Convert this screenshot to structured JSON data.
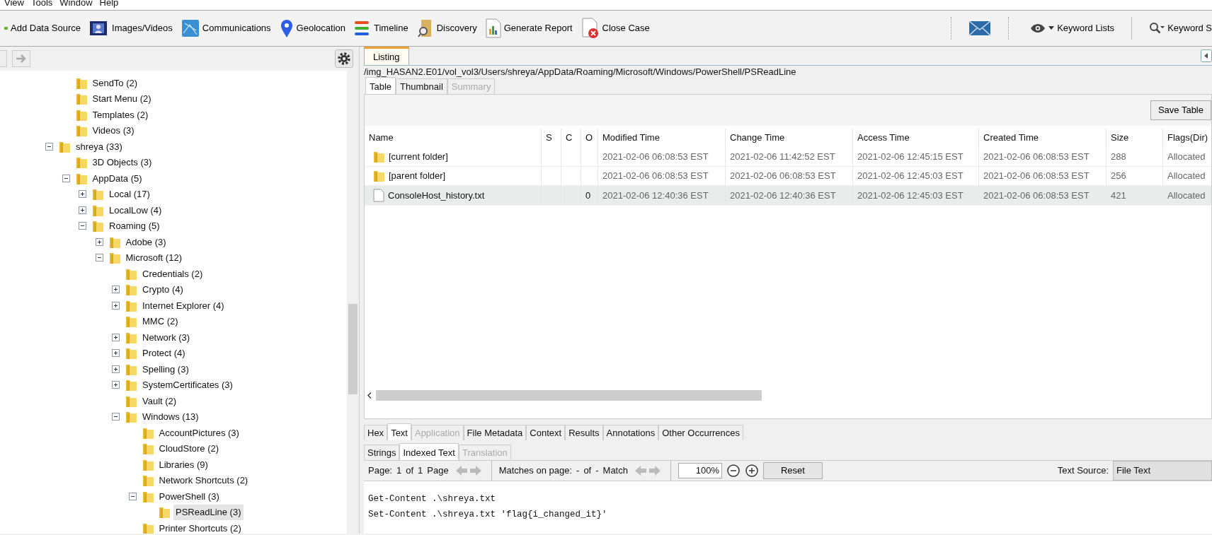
{
  "menu": [
    "View",
    "Tools",
    "Window",
    "Help"
  ],
  "toolbar": [
    {
      "label": "Add Data Source"
    },
    {
      "label": "Images/Videos"
    },
    {
      "label": "Communications"
    },
    {
      "label": "Geolocation"
    },
    {
      "label": "Timeline"
    },
    {
      "label": "Discovery"
    },
    {
      "label": "Generate Report"
    },
    {
      "label": "Close Case"
    }
  ],
  "toolbar_right": [
    {
      "label": "Keyword Lists"
    },
    {
      "label": "Keyword S"
    }
  ],
  "tree": [
    {
      "children": [
        {
          "label": "SendTo (2)"
        },
        {
          "label": "Start Menu (2)"
        },
        {
          "label": "Templates (2)"
        },
        {
          "label": "Videos (3)"
        }
      ]
    },
    {
      "label": "shreya (33)",
      "expanded": true,
      "children": [
        {
          "label": "3D Objects (3)"
        },
        {
          "label": "AppData (5)",
          "expanded": true,
          "children": [
            {
              "label": "Local (17)",
              "expanded": false
            },
            {
              "label": "LocalLow (4)",
              "expanded": false
            },
            {
              "label": "Roaming (5)",
              "expanded": true,
              "children": [
                {
                  "label": "Adobe (3)",
                  "expanded": false
                },
                {
                  "label": "Microsoft (12)",
                  "expanded": true,
                  "children": [
                    {
                      "label": "Credentials (2)"
                    },
                    {
                      "label": "Crypto (4)",
                      "expanded": false
                    },
                    {
                      "label": "Internet Explorer (4)",
                      "expanded": false
                    },
                    {
                      "label": "MMC (2)"
                    },
                    {
                      "label": "Network (3)",
                      "expanded": false
                    },
                    {
                      "label": "Protect (4)",
                      "expanded": false
                    },
                    {
                      "label": "Spelling (3)",
                      "expanded": false
                    },
                    {
                      "label": "SystemCertificates (3)",
                      "expanded": false
                    },
                    {
                      "label": "Vault (2)"
                    },
                    {
                      "label": "Windows (13)",
                      "expanded": true,
                      "children": [
                        {
                          "label": "AccountPictures (3)"
                        },
                        {
                          "label": "CloudStore (2)"
                        },
                        {
                          "label": "Libraries (9)"
                        },
                        {
                          "label": "Network Shortcuts (2)"
                        },
                        {
                          "label": "PowerShell (3)",
                          "expanded": true,
                          "children": [
                            {
                              "label": "PSReadLine (3)",
                              "selected": true
                            }
                          ]
                        },
                        {
                          "label": "Printer Shortcuts (2)"
                        }
                      ]
                    }
                  ]
                }
              ]
            }
          ]
        }
      ]
    }
  ],
  "listing": {
    "tab": "Listing",
    "path": "/img_HASAN2.E01/vol_vol3/Users/shreya/AppData/Roaming/Microsoft/Windows/PowerShell/PSReadLine",
    "tabs": [
      {
        "label": "Table",
        "selected": true,
        "disabled": false
      },
      {
        "label": "Thumbnail",
        "selected": false,
        "disabled": false
      },
      {
        "label": "Summary",
        "selected": false,
        "disabled": true
      }
    ],
    "save_button": "Save Table",
    "columns": [
      "Name",
      "S",
      "C",
      "O",
      "Modified Time",
      "Change Time",
      "Access Time",
      "Created Time",
      "Size",
      "Flags(Dir)"
    ],
    "rows": [
      {
        "kind": "folder",
        "selected": false,
        "cells": [
          "[current folder]",
          "",
          "",
          "",
          "2021-02-06 06:08:53 EST",
          "2021-02-06 11:42:52 EST",
          "2021-02-06 12:45:15 EST",
          "2021-02-06 06:08:53 EST",
          "288",
          "Allocated"
        ]
      },
      {
        "kind": "folder",
        "selected": false,
        "cells": [
          "[parent folder]",
          "",
          "",
          "",
          "2021-02-06 06:08:53 EST",
          "2021-02-06 06:08:53 EST",
          "2021-02-06 12:45:03 EST",
          "2021-02-06 06:08:53 EST",
          "256",
          "Allocated"
        ]
      },
      {
        "kind": "file",
        "selected": true,
        "cells": [
          "ConsoleHost_history.txt",
          "",
          "",
          "0",
          "2021-02-06 12:40:36 EST",
          "2021-02-06 12:40:36 EST",
          "2021-02-06 12:45:03 EST",
          "2021-02-06 06:08:53 EST",
          "421",
          "Allocated"
        ]
      }
    ]
  },
  "content": {
    "tabs": [
      {
        "label": "Hex",
        "selected": false,
        "disabled": false
      },
      {
        "label": "Text",
        "selected": true,
        "disabled": false
      },
      {
        "label": "Application",
        "selected": false,
        "disabled": true
      },
      {
        "label": "File Metadata",
        "selected": false,
        "disabled": false
      },
      {
        "label": "Context",
        "selected": false,
        "disabled": false
      },
      {
        "label": "Results",
        "selected": false,
        "disabled": false
      },
      {
        "label": "Annotations",
        "selected": false,
        "disabled": false
      },
      {
        "label": "Other Occurrences",
        "selected": false,
        "disabled": false
      }
    ],
    "subtabs": [
      {
        "label": "Strings",
        "selected": false,
        "disabled": false
      },
      {
        "label": "Indexed Text",
        "selected": true,
        "disabled": false
      },
      {
        "label": "Translation",
        "selected": false,
        "disabled": true
      }
    ],
    "page_label": "Page:",
    "page": "1",
    "of": "of",
    "pages": "1",
    "page_word": "Page",
    "matches_label": "Matches on page:",
    "match_a": "-",
    "match_of": "of",
    "match_b": "-",
    "match_word": "Match",
    "zoom": "100%",
    "reset": "Reset",
    "source_label": "Text Source:",
    "source": "File Text",
    "lines": [
      "Get-Content .\\shreya.txt",
      "Set-Content .\\shreya.txt 'flag{i_changed_it}'"
    ]
  }
}
